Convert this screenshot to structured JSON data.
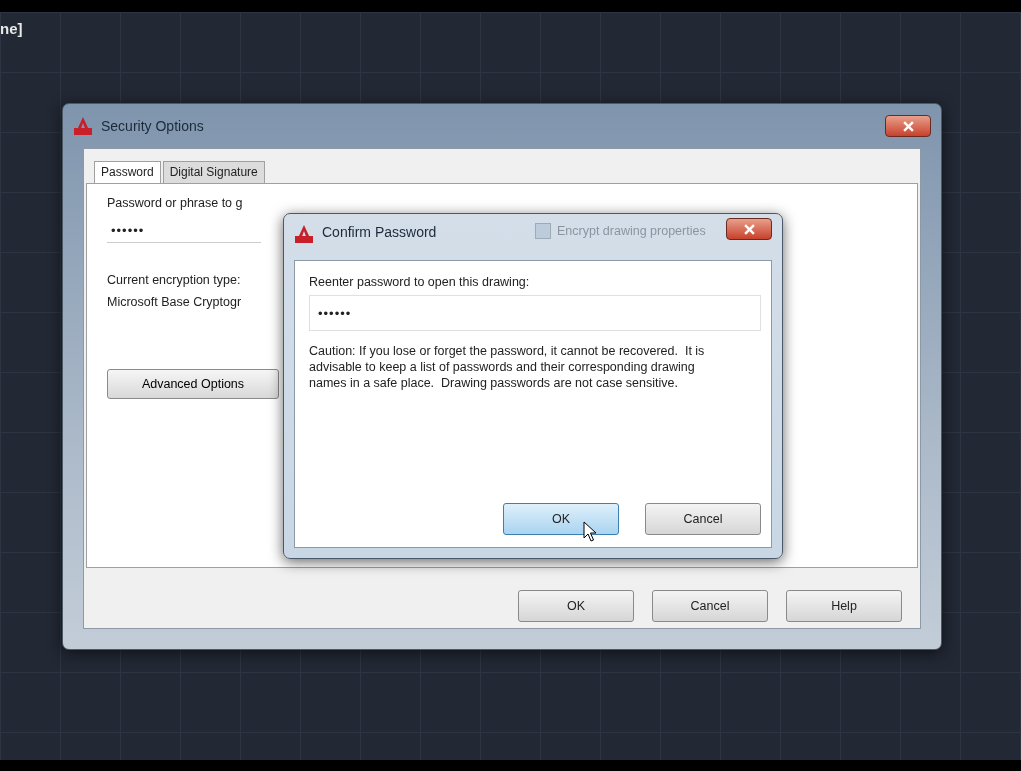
{
  "canvas": {
    "title_fragment": "ne]"
  },
  "security_dialog": {
    "title": "Security Options",
    "tabs": [
      {
        "label": "Password",
        "selected": true
      },
      {
        "label": "Digital Signature",
        "selected": false
      }
    ],
    "password_label": "Password or phrase to g",
    "password_value": "••••••",
    "encrypt_properties": {
      "label": "Encrypt drawing properties",
      "checked": false
    },
    "encryption_type_label": "Current encryption type:",
    "encryption_type_value": "Microsoft Base Cryptogr",
    "advanced_button": "Advanced Options",
    "buttons": [
      "OK",
      "Cancel",
      "Help"
    ]
  },
  "confirm_dialog": {
    "title": "Confirm Password",
    "prompt": "Reenter password to open this drawing:",
    "password_value": "••••••",
    "caution": "Caution: If you lose or forget the password, it cannot be recovered.  It is advisable to keep a list of passwords and their corresponding drawing names in a safe place.  Drawing passwords are not case sensitive.",
    "buttons": [
      {
        "label": "OK",
        "focused": true
      },
      {
        "label": "Cancel",
        "focused": false
      }
    ]
  }
}
